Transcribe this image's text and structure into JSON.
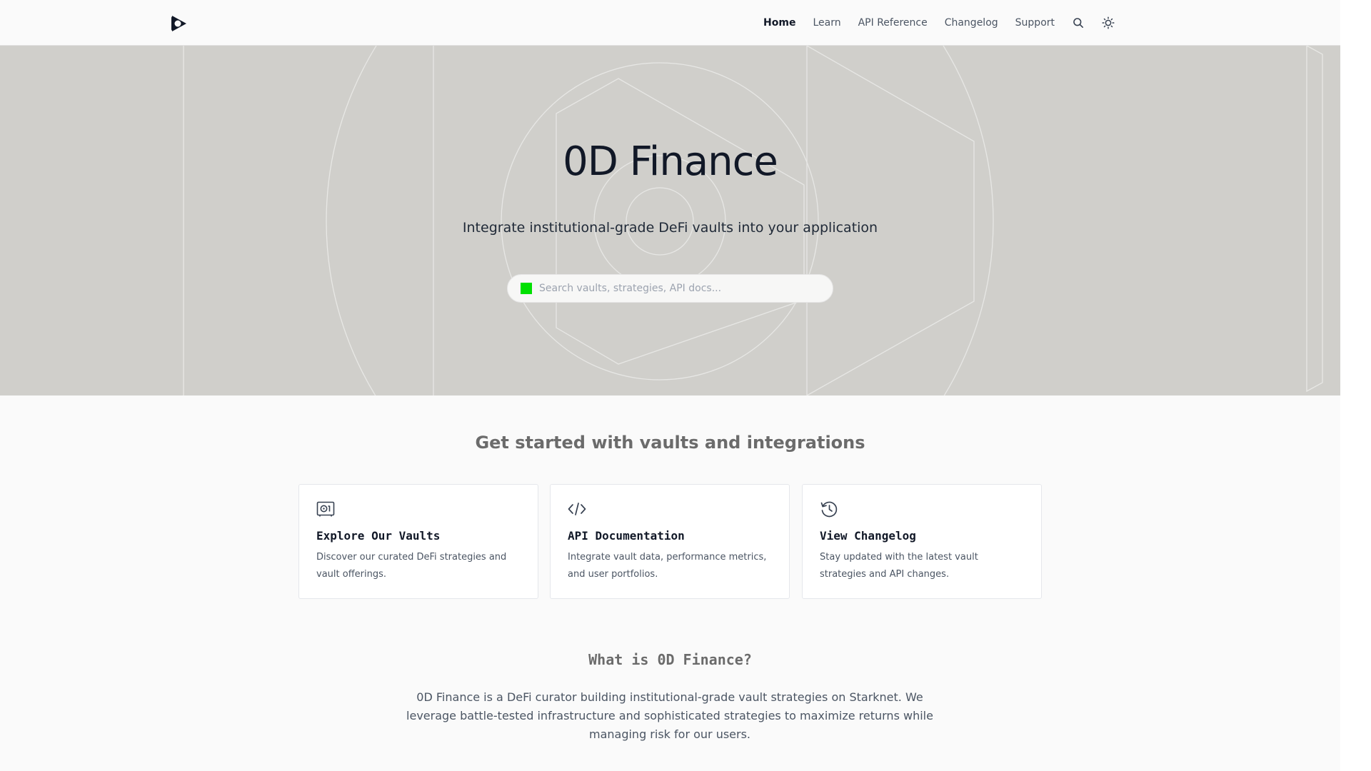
{
  "header": {
    "nav": [
      {
        "label": "Home",
        "active": true
      },
      {
        "label": "Learn",
        "active": false
      },
      {
        "label": "API Reference",
        "active": false
      },
      {
        "label": "Changelog",
        "active": false
      },
      {
        "label": "Support",
        "active": false
      }
    ],
    "icons": [
      "logo-icon",
      "search-icon",
      "theme-toggle-sun-icon"
    ]
  },
  "hero": {
    "title": "0D Finance",
    "subtitle": "Integrate institutional-grade DeFi vaults into your application",
    "search": {
      "placeholder": "Search vaults, strategies, API docs...",
      "value": ""
    }
  },
  "get_started": {
    "title": "Get started with vaults and integrations",
    "cards": [
      {
        "icon": "vault-icon",
        "title": "Explore Our Vaults",
        "description": "Discover our curated DeFi strategies and vault offerings."
      },
      {
        "icon": "code-icon",
        "title": "API Documentation",
        "description": "Integrate vault data, performance metrics, and user portfolios."
      },
      {
        "icon": "history-icon",
        "title": "View Changelog",
        "description": "Stay updated with the latest vault strategies and API changes."
      }
    ]
  },
  "about": {
    "title": "What is 0D Finance?",
    "text": "0D Finance is a DeFi curator building institutional-grade vault strategies on Starknet. We leverage battle-tested infrastructure and sophisticated strategies to maximize returns while managing risk for our users."
  },
  "colors": {
    "hero_background": "#d0cfcb",
    "page_background": "#fafafa",
    "search_marker": "#00e000"
  }
}
